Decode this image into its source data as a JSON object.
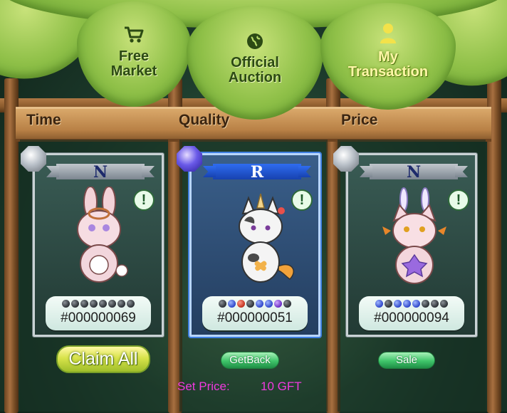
{
  "tabs": [
    {
      "label_line1": "Free",
      "label_line2": "Market",
      "icon": "cart-icon",
      "active": false
    },
    {
      "label_line1": "Official",
      "label_line2": "Auction",
      "icon": "globe-icon",
      "active": false
    },
    {
      "label_line1": "My",
      "label_line2": "Transaction",
      "icon": "user-icon",
      "active": true
    }
  ],
  "headers": {
    "time": "Time",
    "quality": "Quality",
    "price": "Price"
  },
  "cards": [
    {
      "rarity": "N",
      "id": "#000000069",
      "alert": "!",
      "dots": [
        "gray",
        "gray",
        "gray",
        "gray",
        "gray",
        "gray",
        "gray",
        "gray"
      ],
      "pet": "bunny-pet"
    },
    {
      "rarity": "R",
      "id": "#000000051",
      "alert": "!",
      "dots": [
        "gray",
        "blue",
        "red",
        "gray",
        "blue",
        "blue",
        "purple",
        "gray"
      ],
      "pet": "cow-cat-pet"
    },
    {
      "rarity": "N",
      "id": "#000000094",
      "alert": "!",
      "dots": [
        "blue",
        "gray",
        "blue",
        "blue",
        "blue",
        "gray",
        "gray",
        "gray"
      ],
      "pet": "fox-bunny-pet"
    }
  ],
  "buttons": {
    "claim_all": "Claim All",
    "get_back": "GetBack",
    "sale": "Sale"
  },
  "set_price": {
    "label": "Set Price:",
    "value": "10 GFT"
  },
  "colors": {
    "set_price_text": "#f03adf",
    "rare_border": "#3f7fe0",
    "leaf_green": "#8fc048"
  }
}
